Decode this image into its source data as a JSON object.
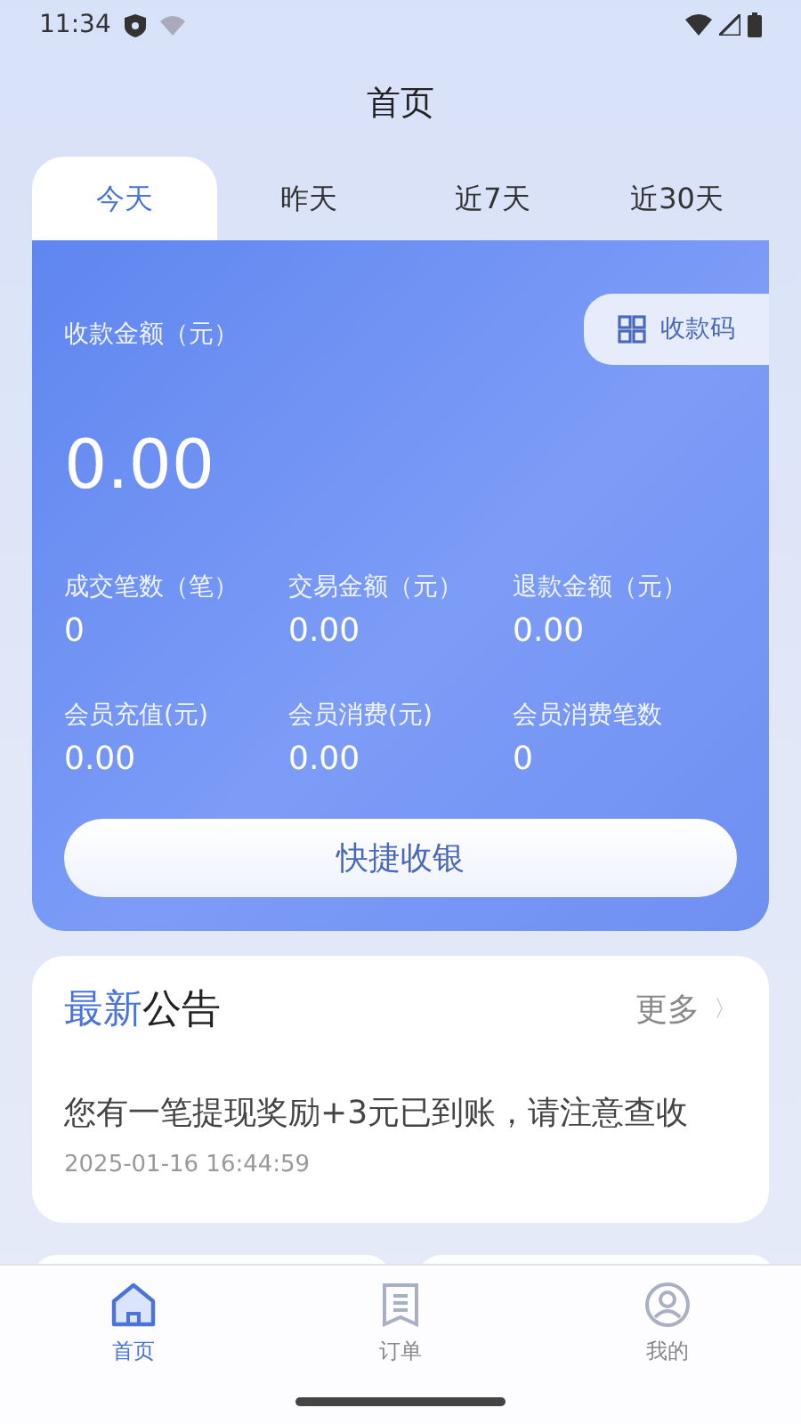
{
  "status_bar": {
    "time": "11:34"
  },
  "header": {
    "title": "首页"
  },
  "tabs": [
    {
      "label": "今天",
      "selected": true
    },
    {
      "label": "昨天",
      "selected": false
    },
    {
      "label": "近7天",
      "selected": false
    },
    {
      "label": "近30天",
      "selected": false
    }
  ],
  "summary": {
    "label": "收款金额（元）",
    "amount": "0.00",
    "qr_button": "收款码",
    "stats": [
      {
        "label": "成交笔数（笔）",
        "value": "0"
      },
      {
        "label": "交易金额（元）",
        "value": "0.00"
      },
      {
        "label": "退款金额（元）",
        "value": "0.00"
      },
      {
        "label": "会员充值(元)",
        "value": "0.00"
      },
      {
        "label": "会员消费(元)",
        "value": "0.00"
      },
      {
        "label": "会员消费笔数",
        "value": "0"
      }
    ],
    "quick_button": "快捷收银"
  },
  "notice": {
    "title_parts": [
      "最新",
      "公告"
    ],
    "more": "更多",
    "more_arrow": "〉",
    "message": "您有一笔提现奖励+3元已到账，请注意查收",
    "time": "2025-01-16 16:44:59"
  },
  "bottom_nav": [
    {
      "label": "首页",
      "selected": true
    },
    {
      "label": "订单",
      "selected": false
    },
    {
      "label": "我的",
      "selected": false
    }
  ]
}
